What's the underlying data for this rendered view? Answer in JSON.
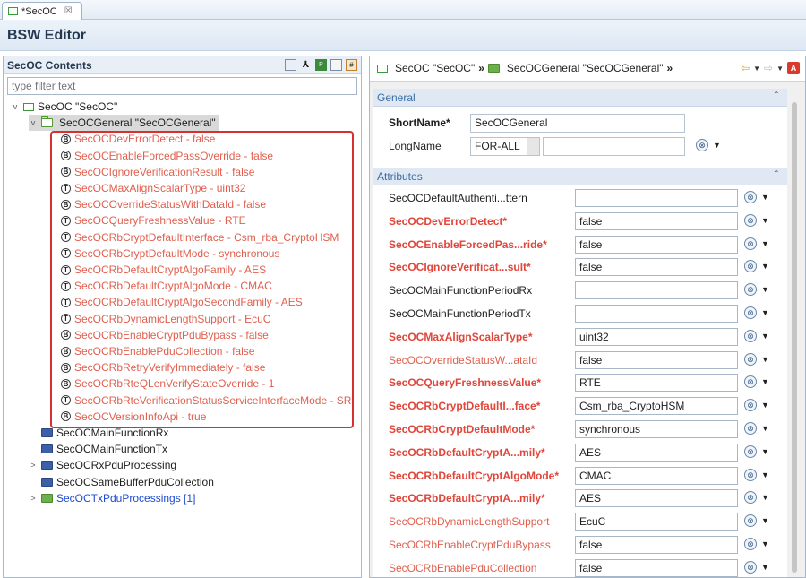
{
  "editor_tab": {
    "label": "*SecOC",
    "close": "☒"
  },
  "title": "BSW Editor",
  "left_panel": {
    "title": "SecOC Contents",
    "filter_placeholder": "type filter text",
    "tree": [
      {
        "label": "SecOC \"SecOC\"",
        "level": 0,
        "expand": "v",
        "icon": "module",
        "style": "normal"
      },
      {
        "label": "SecOCGeneral \"SecOCGeneral\"",
        "level": 1,
        "expand": "v",
        "icon": "folder-outline",
        "style": "selected"
      },
      {
        "label": "SecOCDevErrorDetect - false",
        "level": 2,
        "icon": "param",
        "badge": "B",
        "style": "red"
      },
      {
        "label": "SecOCEnableForcedPassOverride - false",
        "level": 2,
        "icon": "param",
        "badge": "B",
        "style": "red"
      },
      {
        "label": "SecOCIgnoreVerificationResult - false",
        "level": 2,
        "icon": "param",
        "badge": "B",
        "style": "red"
      },
      {
        "label": "SecOCMaxAlignScalarType - uint32",
        "level": 2,
        "icon": "param",
        "badge": "T",
        "style": "red"
      },
      {
        "label": "SecOCOverrideStatusWithDataId - false",
        "level": 2,
        "icon": "param",
        "badge": "B",
        "style": "red"
      },
      {
        "label": "SecOCQueryFreshnessValue - RTE",
        "level": 2,
        "icon": "param",
        "badge": "T",
        "style": "red"
      },
      {
        "label": "SecOCRbCryptDefaultInterface - Csm_rba_CryptoHSM",
        "level": 2,
        "icon": "param",
        "badge": "T",
        "style": "red"
      },
      {
        "label": "SecOCRbCryptDefaultMode - synchronous",
        "level": 2,
        "icon": "param",
        "badge": "T",
        "style": "red"
      },
      {
        "label": "SecOCRbDefaultCryptAlgoFamily - AES",
        "level": 2,
        "icon": "param",
        "badge": "T",
        "style": "red"
      },
      {
        "label": "SecOCRbDefaultCryptAlgoMode - CMAC",
        "level": 2,
        "icon": "param",
        "badge": "T",
        "style": "red"
      },
      {
        "label": "SecOCRbDefaultCryptAlgoSecondFamily - AES",
        "level": 2,
        "icon": "param",
        "badge": "T",
        "style": "red"
      },
      {
        "label": "SecOCRbDynamicLengthSupport - EcuC",
        "level": 2,
        "icon": "param",
        "badge": "T",
        "style": "red"
      },
      {
        "label": "SecOCRbEnableCryptPduBypass - false",
        "level": 2,
        "icon": "param",
        "badge": "B",
        "style": "red"
      },
      {
        "label": "SecOCRbEnablePduCollection - false",
        "level": 2,
        "icon": "param",
        "badge": "B",
        "style": "red"
      },
      {
        "label": "SecOCRbRetryVerifyImmediately - false",
        "level": 2,
        "icon": "param",
        "badge": "B",
        "style": "red"
      },
      {
        "label": "SecOCRbRteQLenVerifyStateOverride - 1",
        "level": 2,
        "icon": "param",
        "badge": "B",
        "style": "red"
      },
      {
        "label": "SecOCRbRteVerificationStatusServiceInterfaceMode - SR",
        "level": 2,
        "icon": "param",
        "badge": "T",
        "style": "red"
      },
      {
        "label": "SecOCVersionInfoApi - true",
        "level": 2,
        "icon": "param",
        "badge": "B",
        "style": "red"
      },
      {
        "label": "SecOCMainFunctionRx",
        "level": 1,
        "icon": "folder-blue",
        "style": "normal"
      },
      {
        "label": "SecOCMainFunctionTx",
        "level": 1,
        "icon": "folder-blue",
        "style": "normal"
      },
      {
        "label": "SecOCRxPduProcessing",
        "level": 1,
        "expand": ">",
        "icon": "folder-blue",
        "style": "normal"
      },
      {
        "label": "SecOCSameBufferPduCollection",
        "level": 1,
        "icon": "folder-blue",
        "style": "normal"
      },
      {
        "label": "SecOCTxPduProcessings [1]",
        "level": 1,
        "expand": ">",
        "icon": "folder-green",
        "style": "blue"
      }
    ]
  },
  "breadcrumb": {
    "items": [
      "SecOC \"SecOC\"",
      "SecOCGeneral \"SecOCGeneral\""
    ],
    "separator": "»",
    "error_badge": "A"
  },
  "general": {
    "title": "General",
    "shortname_label": "ShortName*",
    "shortname_value": "SecOCGeneral",
    "longname_label": "LongName",
    "longname_lang": "FOR-ALL",
    "longname_value": ""
  },
  "attributes": {
    "title": "Attributes",
    "rows": [
      {
        "label": "SecOCDefaultAuthenti...ttern",
        "value": "",
        "style": "normal"
      },
      {
        "label": "SecOCDevErrorDetect*",
        "value": "false",
        "style": "redb"
      },
      {
        "label": "SecOCEnableForcedPas...ride*",
        "value": "false",
        "style": "redb"
      },
      {
        "label": "SecOCIgnoreVerificat...sult*",
        "value": "false",
        "style": "redb"
      },
      {
        "label": "SecOCMainFunctionPeriodRx",
        "value": "",
        "style": "normal"
      },
      {
        "label": "SecOCMainFunctionPeriodTx",
        "value": "",
        "style": "normal"
      },
      {
        "label": "SecOCMaxAlignScalarType*",
        "value": "uint32",
        "style": "redb"
      },
      {
        "label": "SecOCOverrideStatusW...ataId",
        "value": "false",
        "style": "red"
      },
      {
        "label": "SecOCQueryFreshnessValue*",
        "value": "RTE",
        "style": "redb"
      },
      {
        "label": "SecOCRbCryptDefaultI...face*",
        "value": "Csm_rba_CryptoHSM",
        "style": "redb"
      },
      {
        "label": "SecOCRbCryptDefaultMode*",
        "value": "synchronous",
        "style": "redb"
      },
      {
        "label": "SecOCRbDefaultCryptA...mily*",
        "value": "AES",
        "style": "redb"
      },
      {
        "label": "SecOCRbDefaultCryptAlgoMode*",
        "value": "CMAC",
        "style": "redb"
      },
      {
        "label": "SecOCRbDefaultCryptA...mily*",
        "value": "AES",
        "style": "redb"
      },
      {
        "label": "SecOCRbDynamicLengthSupport",
        "value": "EcuC",
        "style": "red"
      },
      {
        "label": "SecOCRbEnableCryptPduBypass",
        "value": "false",
        "style": "red"
      },
      {
        "label": "SecOCRbEnablePduCollection",
        "value": "false",
        "style": "red"
      }
    ]
  },
  "colors": {
    "red": "#e0604f",
    "accent": "#3a6ea5",
    "highlight": "#d63030"
  }
}
